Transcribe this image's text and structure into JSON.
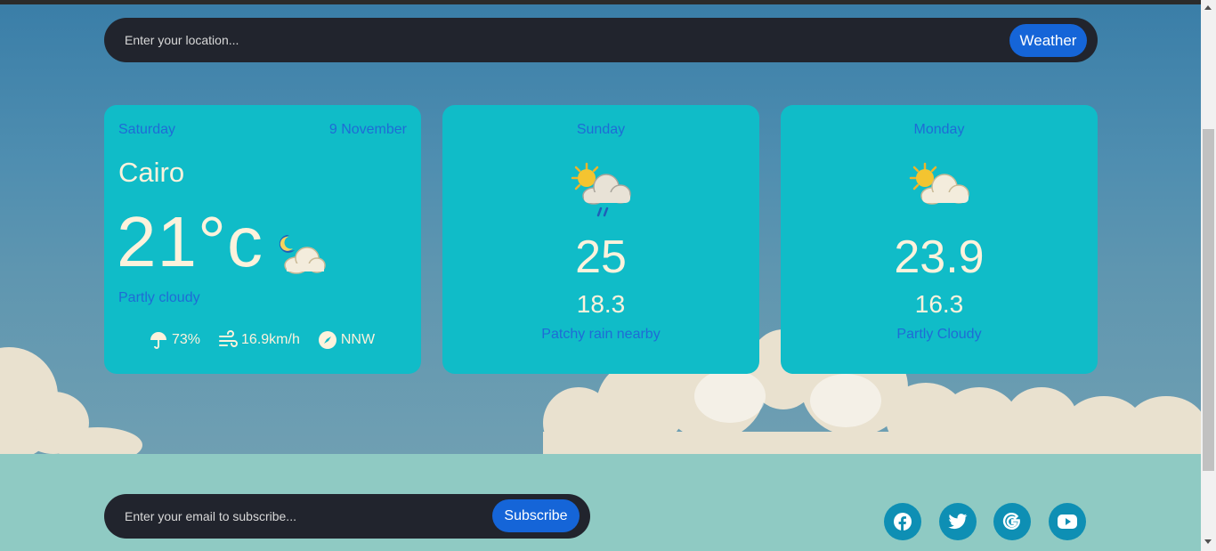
{
  "search": {
    "placeholder": "Enter your location...",
    "button_label": "Weather"
  },
  "today": {
    "day": "Saturday",
    "date": "9 November",
    "city": "Cairo",
    "temperature": "21°c",
    "condition": "Partly cloudy",
    "condition_icon": "moon-cloud-icon",
    "humidity": "73%",
    "wind_speed": "16.9km/h",
    "wind_direction": "NNW"
  },
  "forecast": [
    {
      "day": "Sunday",
      "max": "25",
      "min": "18.3",
      "condition": "Patchy rain nearby",
      "icon": "sun-cloud-rain-icon"
    },
    {
      "day": "Monday",
      "max": "23.9",
      "min": "16.3",
      "condition": "Partly Cloudy",
      "icon": "sun-cloud-icon"
    }
  ],
  "subscribe": {
    "placeholder": "Enter your email to subscribe...",
    "button_label": "Subscribe"
  },
  "social": [
    "facebook-icon",
    "twitter-icon",
    "google-icon",
    "youtube-icon"
  ],
  "colors": {
    "card": "#10bcc8",
    "accent": "#1565d8",
    "label_blue": "#1f6bd6",
    "bar": "#21242d",
    "footer": "#8fcac3"
  }
}
